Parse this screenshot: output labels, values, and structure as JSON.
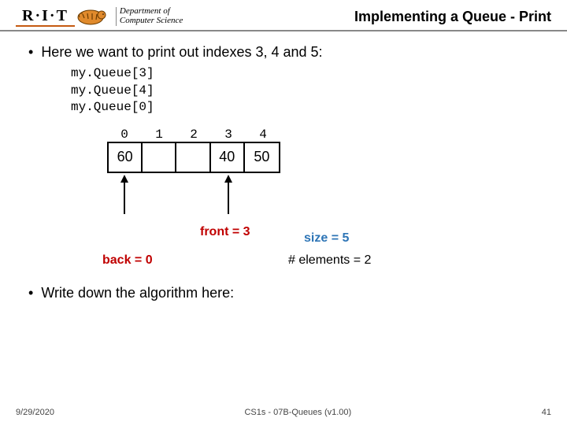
{
  "header": {
    "logo_text": "R·I·T",
    "dept_line1": "Department of",
    "dept_line2": "Computer Science",
    "title": "Implementing a Queue - Print"
  },
  "bullet1": "Here we want to print out indexes 3, 4 and 5:",
  "code": {
    "l1": "my.Queue[3]",
    "l2": "my.Queue[4]",
    "l3": "my.Queue[0]"
  },
  "array": {
    "indices": [
      "0",
      "1",
      "2",
      "3",
      "4"
    ],
    "cells": [
      "60",
      "",
      "",
      "40",
      "50"
    ]
  },
  "labels": {
    "front": "front = 3",
    "back": "back = 0",
    "size": "size = 5",
    "elements": "# elements = 2"
  },
  "bullet2": "Write down the algorithm here:",
  "footer": {
    "date": "9/29/2020",
    "center": "CS1s - 07B-Queues (v1.00)",
    "page": "41"
  }
}
